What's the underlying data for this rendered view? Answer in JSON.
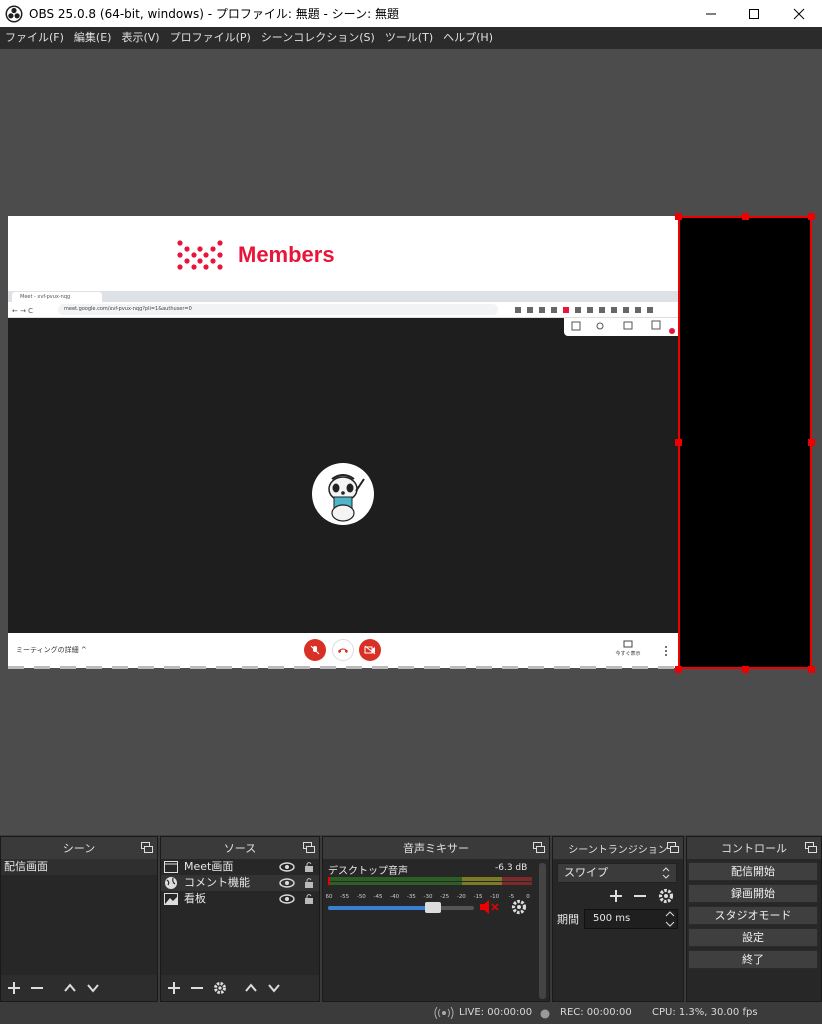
{
  "window": {
    "title": "OBS 25.0.8 (64-bit, windows) - プロファイル: 無題 - シーン: 無題",
    "controls": [
      "minimize-icon",
      "maximize-icon",
      "close-icon"
    ]
  },
  "menu": [
    "ファイル(F)",
    "編集(E)",
    "表示(V)",
    "プロファイル(P)",
    "シーンコレクション(S)",
    "ツール(T)",
    "ヘルプ(H)"
  ],
  "preview": {
    "banner_text": "Members",
    "browser_tab": "Meet - xvf-pvux-nqg",
    "browser_url": "meet.google.com/xvf-pvux-nqg?pli=1&authuser=0",
    "meeting_details": "ミーティングの詳細",
    "present_label": "今すぐ表示",
    "accent_color": "#e8143a",
    "selection_color": "#ee0000"
  },
  "docks": {
    "scenes": {
      "title": "シーン",
      "items": [
        "配信画面"
      ]
    },
    "sources": {
      "title": "ソース",
      "items": [
        {
          "label": "Meet画面",
          "icon": "window-capture-icon"
        },
        {
          "label": "コメント機能",
          "icon": "browser-source-icon"
        },
        {
          "label": "看板",
          "icon": "image-source-icon"
        }
      ]
    },
    "mixer": {
      "title": "音声ミキサー",
      "track_name": "デスクトップ音声",
      "level": "-6.3 dB",
      "ticks": [
        "-60",
        "-55",
        "-50",
        "-45",
        "-40",
        "-35",
        "-30",
        "-25",
        "-20",
        "-15",
        "-10",
        "-5",
        "0"
      ],
      "volume_fraction": 0.72
    },
    "transitions": {
      "title": "シーントランジション",
      "selected": "スワイプ",
      "duration_label": "期間",
      "duration_value": "500 ms"
    },
    "controls": {
      "title": "コントロール",
      "buttons": [
        "配信開始",
        "録画開始",
        "スタジオモード",
        "設定",
        "終了"
      ]
    }
  },
  "status": {
    "live": "LIVE: 00:00:00",
    "rec": "REC: 00:00:00",
    "cpu": "CPU: 1.3%, 30.00 fps"
  }
}
